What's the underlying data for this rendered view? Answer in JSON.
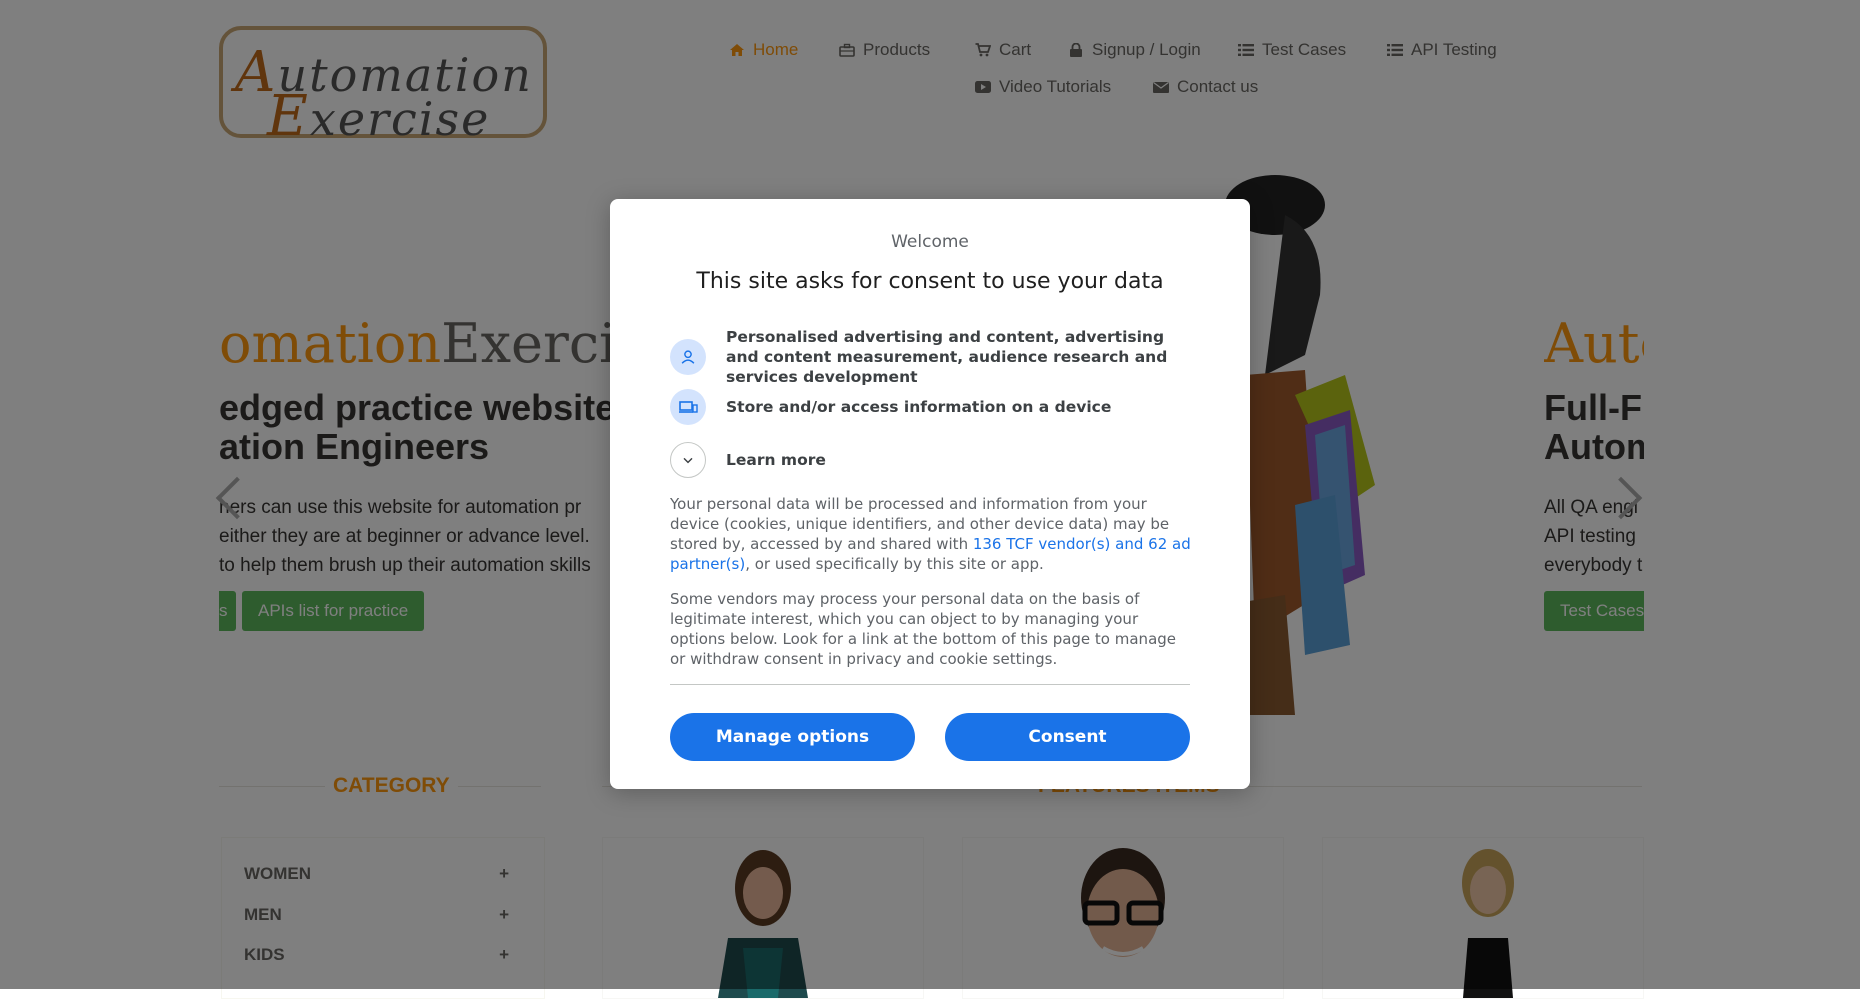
{
  "header": {
    "logo": {
      "line1_cap": "A",
      "line1_rest": "utomation",
      "line2_cap": "E",
      "line2_rest": "xercise"
    },
    "nav": [
      {
        "label": "Home",
        "icon": "home-icon"
      },
      {
        "label": "Products",
        "icon": "briefcase-icon"
      },
      {
        "label": "Cart",
        "icon": "cart-icon"
      },
      {
        "label": "Signup / Login",
        "icon": "lock-icon"
      },
      {
        "label": "Test Cases",
        "icon": "list-icon"
      },
      {
        "label": "API Testing",
        "icon": "list-icon"
      },
      {
        "label": "Video Tutorials",
        "icon": "youtube-play-icon"
      },
      {
        "label": "Contact us",
        "icon": "envelope-icon"
      }
    ]
  },
  "slider": {
    "left": {
      "brand_a": "omation",
      "brand_b": "Exercise",
      "title_line1": "edged practice website fo",
      "title_line2": "ation Engineers",
      "text_line1": "ners can use this website for automation pr",
      "text_line2": "either they are at beginner or advance level.",
      "text_line3": "to help them brush up their automation skills",
      "btn_partial": "s",
      "btn_apis": "APIs list for practice"
    },
    "right": {
      "brand": "Auto",
      "title_line1": "Full-Fl",
      "title_line2": "Autom",
      "text_line1": "All QA engi",
      "text_line2": "API testing",
      "text_line3": "everybody t",
      "btn": "Test Cases"
    }
  },
  "category": {
    "title": "CATEGORY",
    "items": [
      {
        "label": "WOMEN",
        "toggle": "+"
      },
      {
        "label": "MEN",
        "toggle": "+"
      },
      {
        "label": "KIDS",
        "toggle": "+"
      }
    ]
  },
  "features": {
    "title": "FEATURES ITEMS"
  },
  "consent": {
    "welcome": "Welcome",
    "title": "This site asks for consent to use your data",
    "purposes": [
      {
        "icon": "person-icon",
        "text": "Personalised advertising and content, advertising and content measurement, audience research and services development"
      },
      {
        "icon": "devices-icon",
        "text": "Store and/or access information on a device"
      }
    ],
    "learn_more": "Learn more",
    "para1_before": "Your personal data will be processed and information from your device (cookies, unique identifiers, and other device data) may be stored by, accessed by and shared with ",
    "para1_link": "136 TCF vendor(s) and 62 ad partner(s)",
    "para1_after": ", or used specifically by this site or app.",
    "para2": "Some vendors may process your personal data on the basis of legitimate interest, which you can object to by managing your options below. Look for a link at the bottom of this page to manage or withdraw consent in privacy and cookie settings.",
    "manage_label": "Manage options",
    "consent_label": "Consent"
  },
  "colors": {
    "accent": "#fe980f",
    "green_button": "#5cb85c",
    "dialog_button": "#1a73e8",
    "link": "#1a73e8"
  }
}
